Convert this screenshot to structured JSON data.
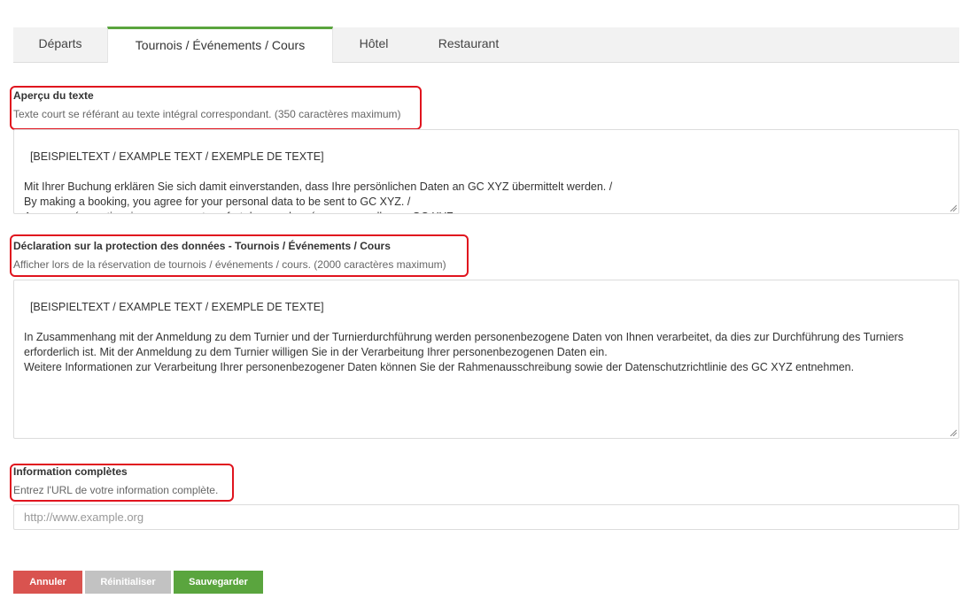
{
  "tabs": [
    {
      "label": "Départs"
    },
    {
      "label": "Tournois / Événements / Cours"
    },
    {
      "label": "Hôtel"
    },
    {
      "label": "Restaurant"
    }
  ],
  "active_tab": "Tournois / Événements / Cours",
  "sections": {
    "preview": {
      "label": "Aperçu du texte",
      "help": "Texte court se référant au texte intégral correspondant. (350 caractères maximum)",
      "value": "[BEISPIELTEXT / EXAMPLE TEXT / EXEMPLE DE TEXTE]\n\nMit Ihrer Buchung erklären Sie sich damit einverstanden, dass Ihre persönlichen Daten an GC XYZ übermittelt werden. /\nBy making a booking, you agree for your personal data to be sent to GC XYZ. /\nAvec ma réservation, je consens au transfert de mes données personnelles au GC XYZ."
    },
    "privacy": {
      "label": "Déclaration sur la protection des données - Tournois / Événements / Cours",
      "help": "Afficher lors de la réservation de tournois / événements / cours. (2000 caractères maximum)",
      "value": "[BEISPIELTEXT / EXAMPLE TEXT / EXEMPLE DE TEXTE]\n\nIn Zusammenhang mit der Anmeldung zu dem Turnier und der Turnierdurchführung werden personenbezogene Daten von Ihnen verarbeitet, da dies zur Durchführung des Turniers erforderlich ist. Mit der Anmeldung zu dem Turnier willigen Sie in der Verarbeitung Ihrer personenbezogenen Daten ein.\nWeitere Informationen zur Verarbeitung Ihrer personenbezogener Daten können Sie der Rahmenausschreibung sowie der Datenschutzrichtlinie des GC XYZ entnehmen."
    },
    "full_info": {
      "label": "Information complètes",
      "help": "Entrez l'URL de votre information complète.",
      "placeholder": "http://www.example.org"
    }
  },
  "buttons": {
    "cancel": "Annuler",
    "reset": "Réinitialiser",
    "save": "Sauvegarder"
  },
  "colors": {
    "accent": "#5aa53e",
    "cancel": "#d9534f",
    "reset": "#c2c2c2",
    "save": "#5aa53e",
    "highlight": "#e0141e"
  }
}
